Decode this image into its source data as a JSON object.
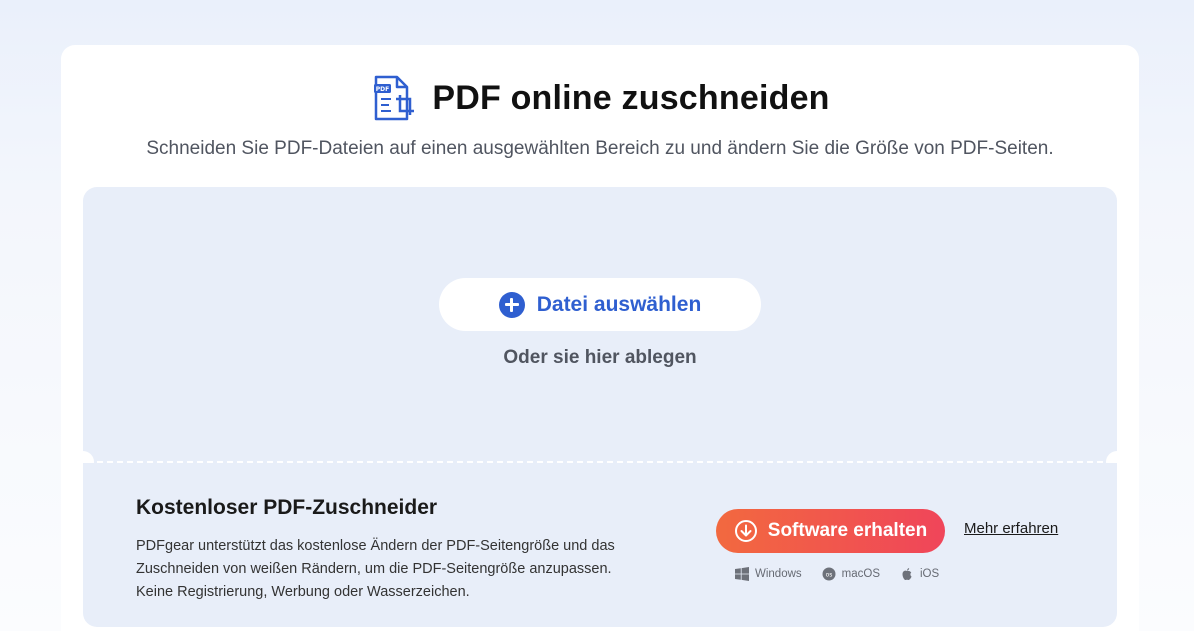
{
  "header": {
    "title": "PDF online zuschneiden",
    "subtitle": "Schneiden Sie PDF-Dateien auf einen ausgewählten Bereich zu und ändern Sie die Größe von PDF-Seiten.",
    "icon_badge_text": "PDF"
  },
  "upload": {
    "button_label": "Datei auswählen",
    "drop_hint": "Oder sie hier ablegen"
  },
  "promo": {
    "title": "Kostenloser PDF-Zuschneider",
    "description_lines": [
      "PDFgear unterstützt das kostenlose Ändern der PDF-Seitengröße und das",
      "Zuschneiden von weißen Rändern, um die PDF-Seitengröße anzupassen.",
      "Keine Registrierung, Werbung oder Wasserzeichen."
    ],
    "cta_label": "Software erhalten",
    "learn_more_label": "Mehr erfahren",
    "platforms": [
      {
        "label": "Windows",
        "icon": "windows-icon"
      },
      {
        "label": "macOS",
        "icon": "macos-icon"
      },
      {
        "label": "iOS",
        "icon": "apple-icon"
      }
    ]
  },
  "colors": {
    "accent_blue": "#2f5fd0",
    "cta_gradient_start": "#f2693f",
    "cta_gradient_end": "#f0455a",
    "panel_bg": "#e8eef9"
  }
}
